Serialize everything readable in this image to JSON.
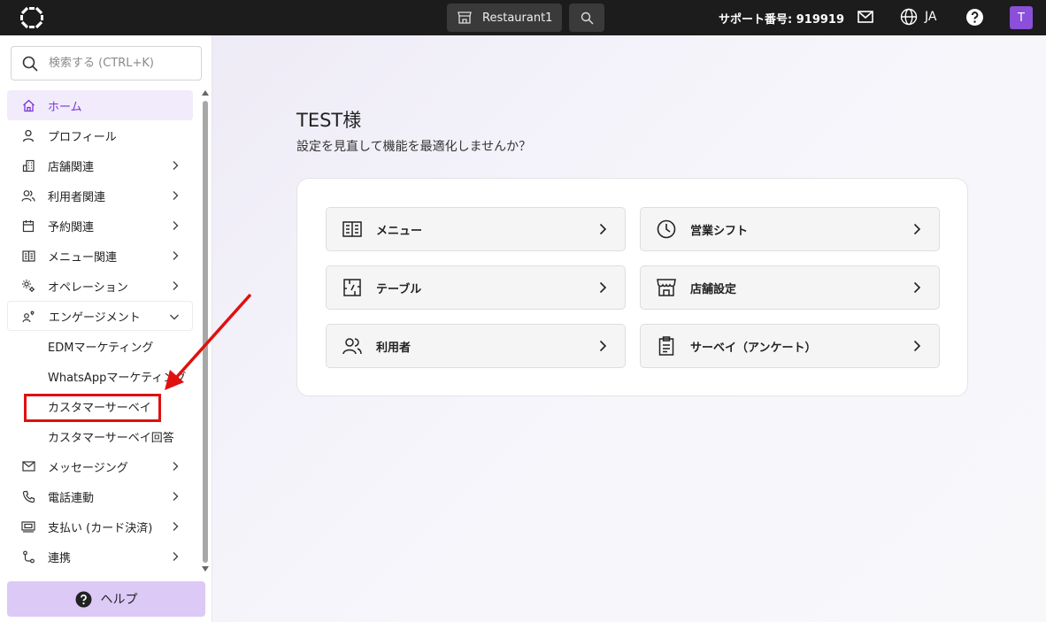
{
  "topbar": {
    "store_name": "Restaurant1",
    "support": "サポート番号: 919919",
    "language": "JA",
    "avatar_initial": "T"
  },
  "sidebar": {
    "search_placeholder": "検索する (CTRL+K)",
    "items": [
      {
        "label": "ホーム",
        "icon": "home-icon",
        "active": true
      },
      {
        "label": "プロフィール",
        "icon": "user-icon"
      },
      {
        "label": "店舗関連",
        "icon": "building-icon",
        "expandable": true
      },
      {
        "label": "利用者関連",
        "icon": "users-icon",
        "expandable": true
      },
      {
        "label": "予約関連",
        "icon": "calendar-icon",
        "expandable": true
      },
      {
        "label": "メニュー関連",
        "icon": "menu-book-icon",
        "expandable": true
      },
      {
        "label": "オペレーション",
        "icon": "operations-gear-icon",
        "expandable": true
      },
      {
        "label": "エンゲージメント",
        "icon": "engagement-icon",
        "expandable": true,
        "expanded": true
      },
      {
        "label": "メッセージング",
        "icon": "mail-icon",
        "expandable": true
      },
      {
        "label": "電話連動",
        "icon": "phone-icon",
        "expandable": true
      },
      {
        "label": "支払い (カード決済)",
        "icon": "payment-icon",
        "expandable": true
      },
      {
        "label": "連携",
        "icon": "integration-icon",
        "expandable": true
      }
    ],
    "sub_items": [
      "EDMマーケティング",
      "WhatsAppマーケティング",
      "カスタマーサーベイ",
      "カスタマーサーベイ回答"
    ],
    "help_label": "ヘルプ"
  },
  "main": {
    "greeting": "TEST様",
    "subtitle": "設定を見直して機能を最適化しませんか？",
    "tiles": [
      {
        "label": "メニュー",
        "icon": "menu-book-icon"
      },
      {
        "label": "営業シフト",
        "icon": "clock-icon"
      },
      {
        "label": "テーブル",
        "icon": "table-icon"
      },
      {
        "label": "店舗設定",
        "icon": "storefront-icon"
      },
      {
        "label": "利用者",
        "icon": "users-icon"
      },
      {
        "label": "サーベイ（アンケート）",
        "icon": "clipboard-icon"
      }
    ]
  },
  "colors": {
    "accent": "#7a35d4",
    "active_bg": "#f1ebfb",
    "help_bg": "#dcc9f6",
    "topbar_bg": "#1c1c1c",
    "annotation_red": "#e01010"
  }
}
